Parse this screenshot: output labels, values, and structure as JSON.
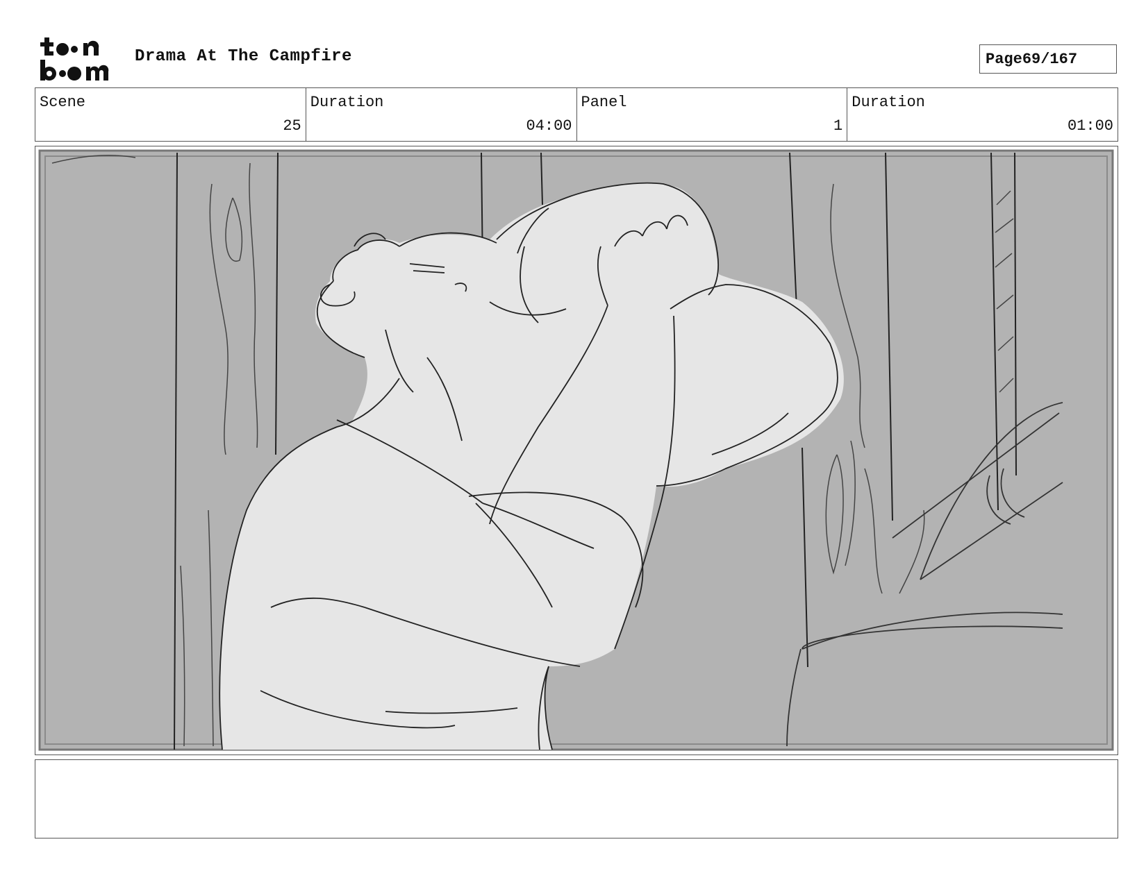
{
  "header": {
    "logo_text": "toonboom",
    "title": "Drama At The Campfire",
    "page_label": "Page",
    "page_value": "69/167"
  },
  "info": {
    "scene_label": "Scene",
    "scene_value": "25",
    "scene_duration_label": "Duration",
    "scene_duration_value": "04:00",
    "panel_label": "Panel",
    "panel_value": "1",
    "panel_duration_label": "Duration",
    "panel_duration_value": "01:00"
  },
  "notes": {
    "text": ""
  },
  "colors": {
    "background_grey": "#b3b3b3",
    "figure_light": "#e6e6e6",
    "line_dark": "#222222"
  }
}
